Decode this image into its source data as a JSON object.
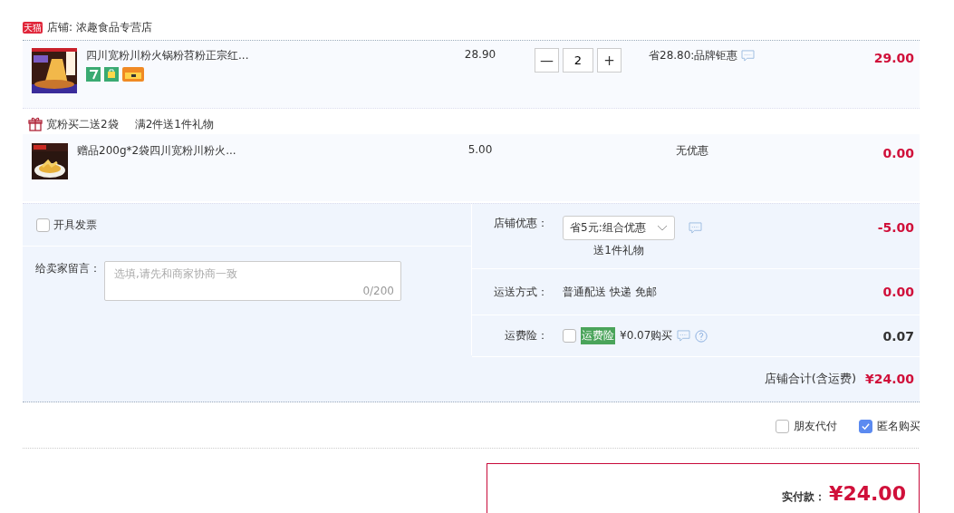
{
  "shop": {
    "badge": "天猫",
    "label": "店铺: 浓趣食品专营店"
  },
  "items": [
    {
      "kind": "product",
      "name": "四川宽粉川粉火锅粉苕粉正宗红...",
      "price": "28.90",
      "quantity": "2",
      "minus": "—",
      "plus": "+",
      "discount": "省28.80:品牌钜惠",
      "subtotal": "29.00"
    }
  ],
  "promo": {
    "title": "宽粉买二送2袋",
    "detail": "满2件送1件礼物"
  },
  "gifts": [
    {
      "kind": "gift",
      "name": "赠品200g*2袋四川宽粉川粉火...",
      "price": "5.00",
      "discount": "无优惠",
      "subtotal": "0.00"
    }
  ],
  "invoice": {
    "label": "开具发票",
    "checked": false
  },
  "message": {
    "label": "给卖家留言：",
    "placeholder": "选填,请先和商家协商一致",
    "counter": "0/200"
  },
  "fees": [
    {
      "kind": "select",
      "label": "店铺优惠：",
      "value": "省5元:组合优惠",
      "note": "送1件礼物",
      "amount": "-5.00",
      "highlighted": true
    },
    {
      "kind": "text",
      "label": "运送方式：",
      "value": "普通配送 快递 免邮",
      "amount": "0.00",
      "highlighted": true
    },
    {
      "kind": "insurance",
      "label": "运费险：",
      "checked": false,
      "tag": "运费险",
      "value": "¥0.07购买",
      "amount": "0.07",
      "highlighted": false
    }
  ],
  "total": {
    "label": "店铺合计(含运费)",
    "value": "¥24.00"
  },
  "options": [
    {
      "label": "朋友代付",
      "checked": false
    },
    {
      "label": "匿名购买",
      "checked": true
    }
  ],
  "pay": {
    "label": "实付款：",
    "value": "¥24.00"
  }
}
